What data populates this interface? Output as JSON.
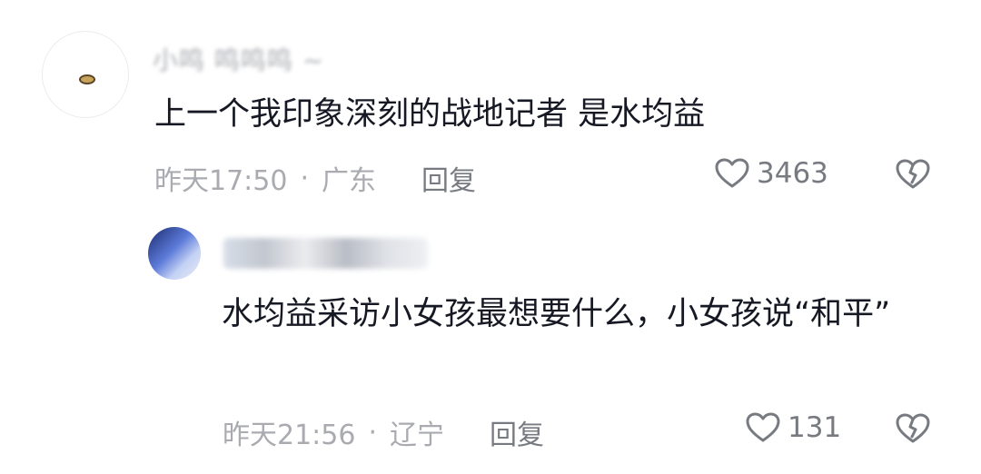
{
  "comment": {
    "username": "小鸣 鸣鸣鸣 ~",
    "text": "上一个我印象深刻的战地记者 是水均益",
    "time": "昨天17:50",
    "separator": "·",
    "location": "广东",
    "reply_label": "回复",
    "likes": "3463"
  },
  "reply": {
    "username": "",
    "text": "水均益采访小女孩最想要什么，小女孩说“和平”",
    "time": "昨天21:56",
    "separator": "·",
    "location": "辽宁",
    "reply_label": "回复",
    "likes": "131"
  },
  "icons": {
    "like": "heart-outline-icon",
    "dislike": "broken-heart-icon"
  },
  "colors": {
    "text": "#161823",
    "meta": "#a9abb0",
    "action": "#777a80"
  }
}
